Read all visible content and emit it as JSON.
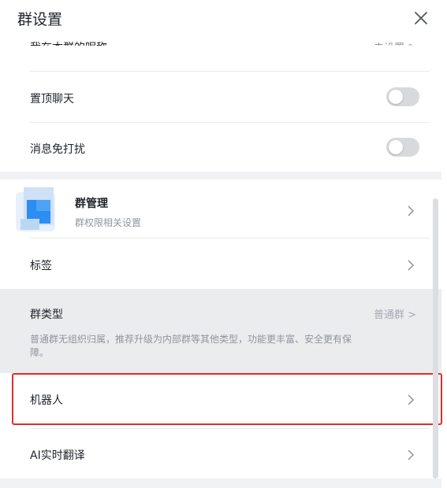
{
  "header": {
    "title": "群设置",
    "close_icon": "close-icon"
  },
  "rows": {
    "nickname": {
      "label": "我在本群的昵称",
      "value": "未设置 ✎"
    },
    "pin_chat": {
      "label": "置顶聊天",
      "toggle": false
    },
    "mute": {
      "label": "消息免打扰",
      "toggle": false
    },
    "group_manage": {
      "label": "群管理",
      "sub": "群权限相关设置"
    },
    "tags": {
      "label": "标签"
    },
    "group_type": {
      "label": "群类型",
      "value": "普通群 >",
      "desc": "普通群无组织归属，推荐升级为内部群等其他类型，功能更丰富、安全更有保障。"
    },
    "robot": {
      "label": "机器人"
    },
    "ai_translate": {
      "label": "AI实时翻译"
    }
  },
  "colors": {
    "highlight": "#e22b2b",
    "toggle_off": "#d7d9dd",
    "section_bg": "#f1f2f4",
    "grey_row": "#ebecee"
  }
}
